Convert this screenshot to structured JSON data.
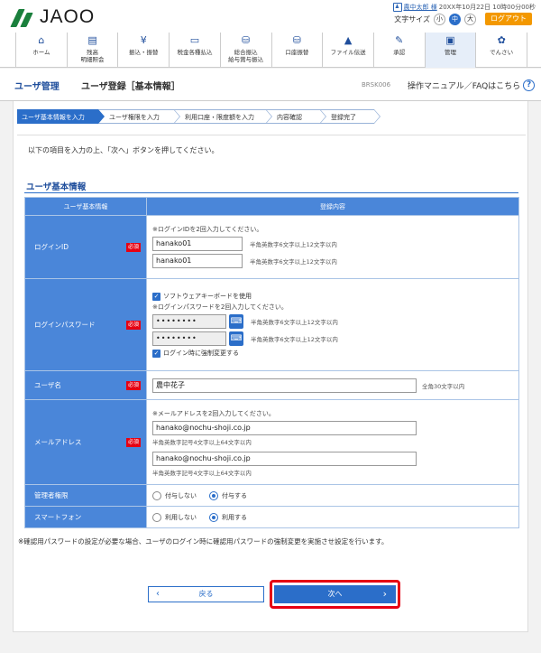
{
  "header": {
    "logo_text": "JAOO",
    "user_name": "農中太郎 様",
    "login_time": "20XX年10月22日 10時00分00秒",
    "font_size_label": "文字サイズ",
    "font_sizes": [
      "小",
      "中",
      "大"
    ],
    "logout_label": "ログアウト"
  },
  "nav": [
    {
      "label": "ホーム",
      "icon": "home-icon",
      "glyph": "⌂"
    },
    {
      "label": "残高\n明細照会",
      "icon": "balance-icon",
      "glyph": "▤"
    },
    {
      "label": "振込・振替",
      "icon": "transfer-icon",
      "glyph": "¥"
    },
    {
      "label": "税金各種払込",
      "icon": "tax-icon",
      "glyph": "▭"
    },
    {
      "label": "総合振込\n給与賞与振込",
      "icon": "bulk-transfer-icon",
      "glyph": "⛁"
    },
    {
      "label": "口座振替",
      "icon": "account-transfer-icon",
      "glyph": "⛁"
    },
    {
      "label": "ファイル伝送",
      "icon": "file-icon",
      "glyph": "▲"
    },
    {
      "label": "承認",
      "icon": "approval-icon",
      "glyph": "✎"
    },
    {
      "label": "管理",
      "icon": "admin-icon",
      "glyph": "▣"
    },
    {
      "label": "でんさい",
      "icon": "densai-icon",
      "glyph": "✿"
    }
  ],
  "title": {
    "category": "ユーザ管理",
    "page": "ユーザ登録［基本情報］",
    "screen_id": "BRSK006",
    "manual": "操作マニュアル／FAQはこちら"
  },
  "steps": [
    "ユーザ基本情報を入力",
    "ユーザ権限を入力",
    "利用口座・限度額を入力",
    "内容確認",
    "登録完了"
  ],
  "intro": "以下の項目を入力の上、「次へ」ボタンを押してください。",
  "section_title": "ユーザ基本情報",
  "table": {
    "col1": "ユーザ基本情報",
    "col2": "登録内容",
    "required": "必須",
    "login_id": {
      "label": "ログインID",
      "note": "※ログインIDを2回入力してください。",
      "value1": "hanako01",
      "value2": "hanako01",
      "hint": "半角英数字6文字以上12文字以内"
    },
    "password": {
      "label": "ログインパスワード",
      "soft_kb": "ソフトウェアキーボードを使用",
      "note": "※ログインパスワードを2回入力してください。",
      "value1": "••••••••",
      "value2": "••••••••",
      "hint": "半角英数字6文字以上12文字以内",
      "force_change": "ログイン時に強制変更する"
    },
    "user_name": {
      "label": "ユーザ名",
      "value": "農中花子",
      "hint": "全角30文字以内"
    },
    "email": {
      "label": "メールアドレス",
      "note": "※メールアドレスを2回入力してください。",
      "value1": "hanako@nochu-shoji.co.jp",
      "value2": "hanako@nochu-shoji.co.jp",
      "hint": "半角英数字記号4文字以上64文字以内"
    },
    "admin": {
      "label": "管理者権限",
      "opt_off": "付与しない",
      "opt_on": "付与する"
    },
    "smartphone": {
      "label": "スマートフォン",
      "opt_off": "利用しない",
      "opt_on": "利用する"
    }
  },
  "footnote": "※確認用パスワードの設定が必要な場合、ユーザのログイン時に確認用パスワードの強制変更を実施させ設定を行います。",
  "buttons": {
    "back": "戻る",
    "next": "次へ"
  },
  "colors": {
    "primary": "#2b6ec9",
    "required": "#e60012",
    "logout": "#f39800",
    "brand": "#1a7f3c"
  }
}
